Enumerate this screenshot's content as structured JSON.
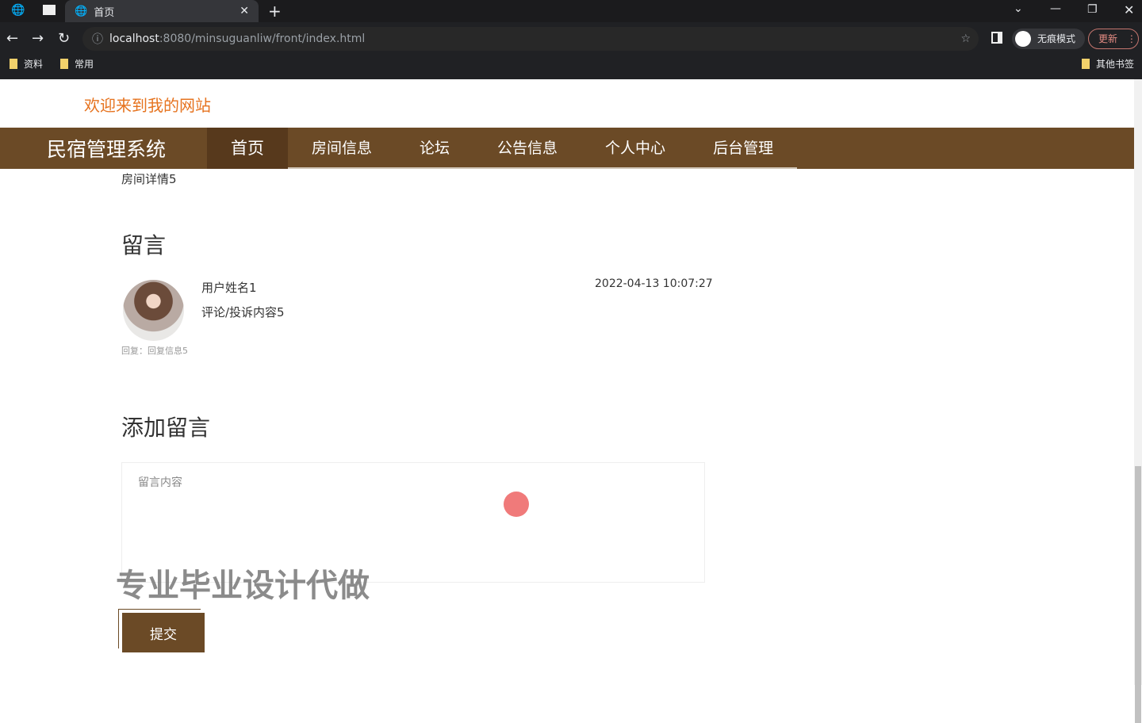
{
  "browser": {
    "tab_title": "首页",
    "url_host": "localhost",
    "url_rest": ":8080/minsuguanliw/front/index.html",
    "bookmarks": [
      "资料",
      "常用"
    ],
    "other_bookmarks": "其他书签",
    "incognito": "无痕模式",
    "update": "更新"
  },
  "site": {
    "welcome": "欢迎来到我的网站",
    "brand": "民宿管理系统",
    "nav": [
      "首页",
      "房间信息",
      "论坛",
      "公告信息",
      "个人中心",
      "后台管理"
    ]
  },
  "detail": {
    "room_detail": "房间详情5",
    "comments_heading": "留言",
    "comment": {
      "user": "用户姓名1",
      "time": "2022-04-13 10:07:27",
      "content": "评论/投诉内容5",
      "reply": "回复：回复信息5"
    },
    "add_heading": "添加留言",
    "placeholder": "留言内容",
    "submit": "提交"
  },
  "watermark": "专业毕业设计代做"
}
